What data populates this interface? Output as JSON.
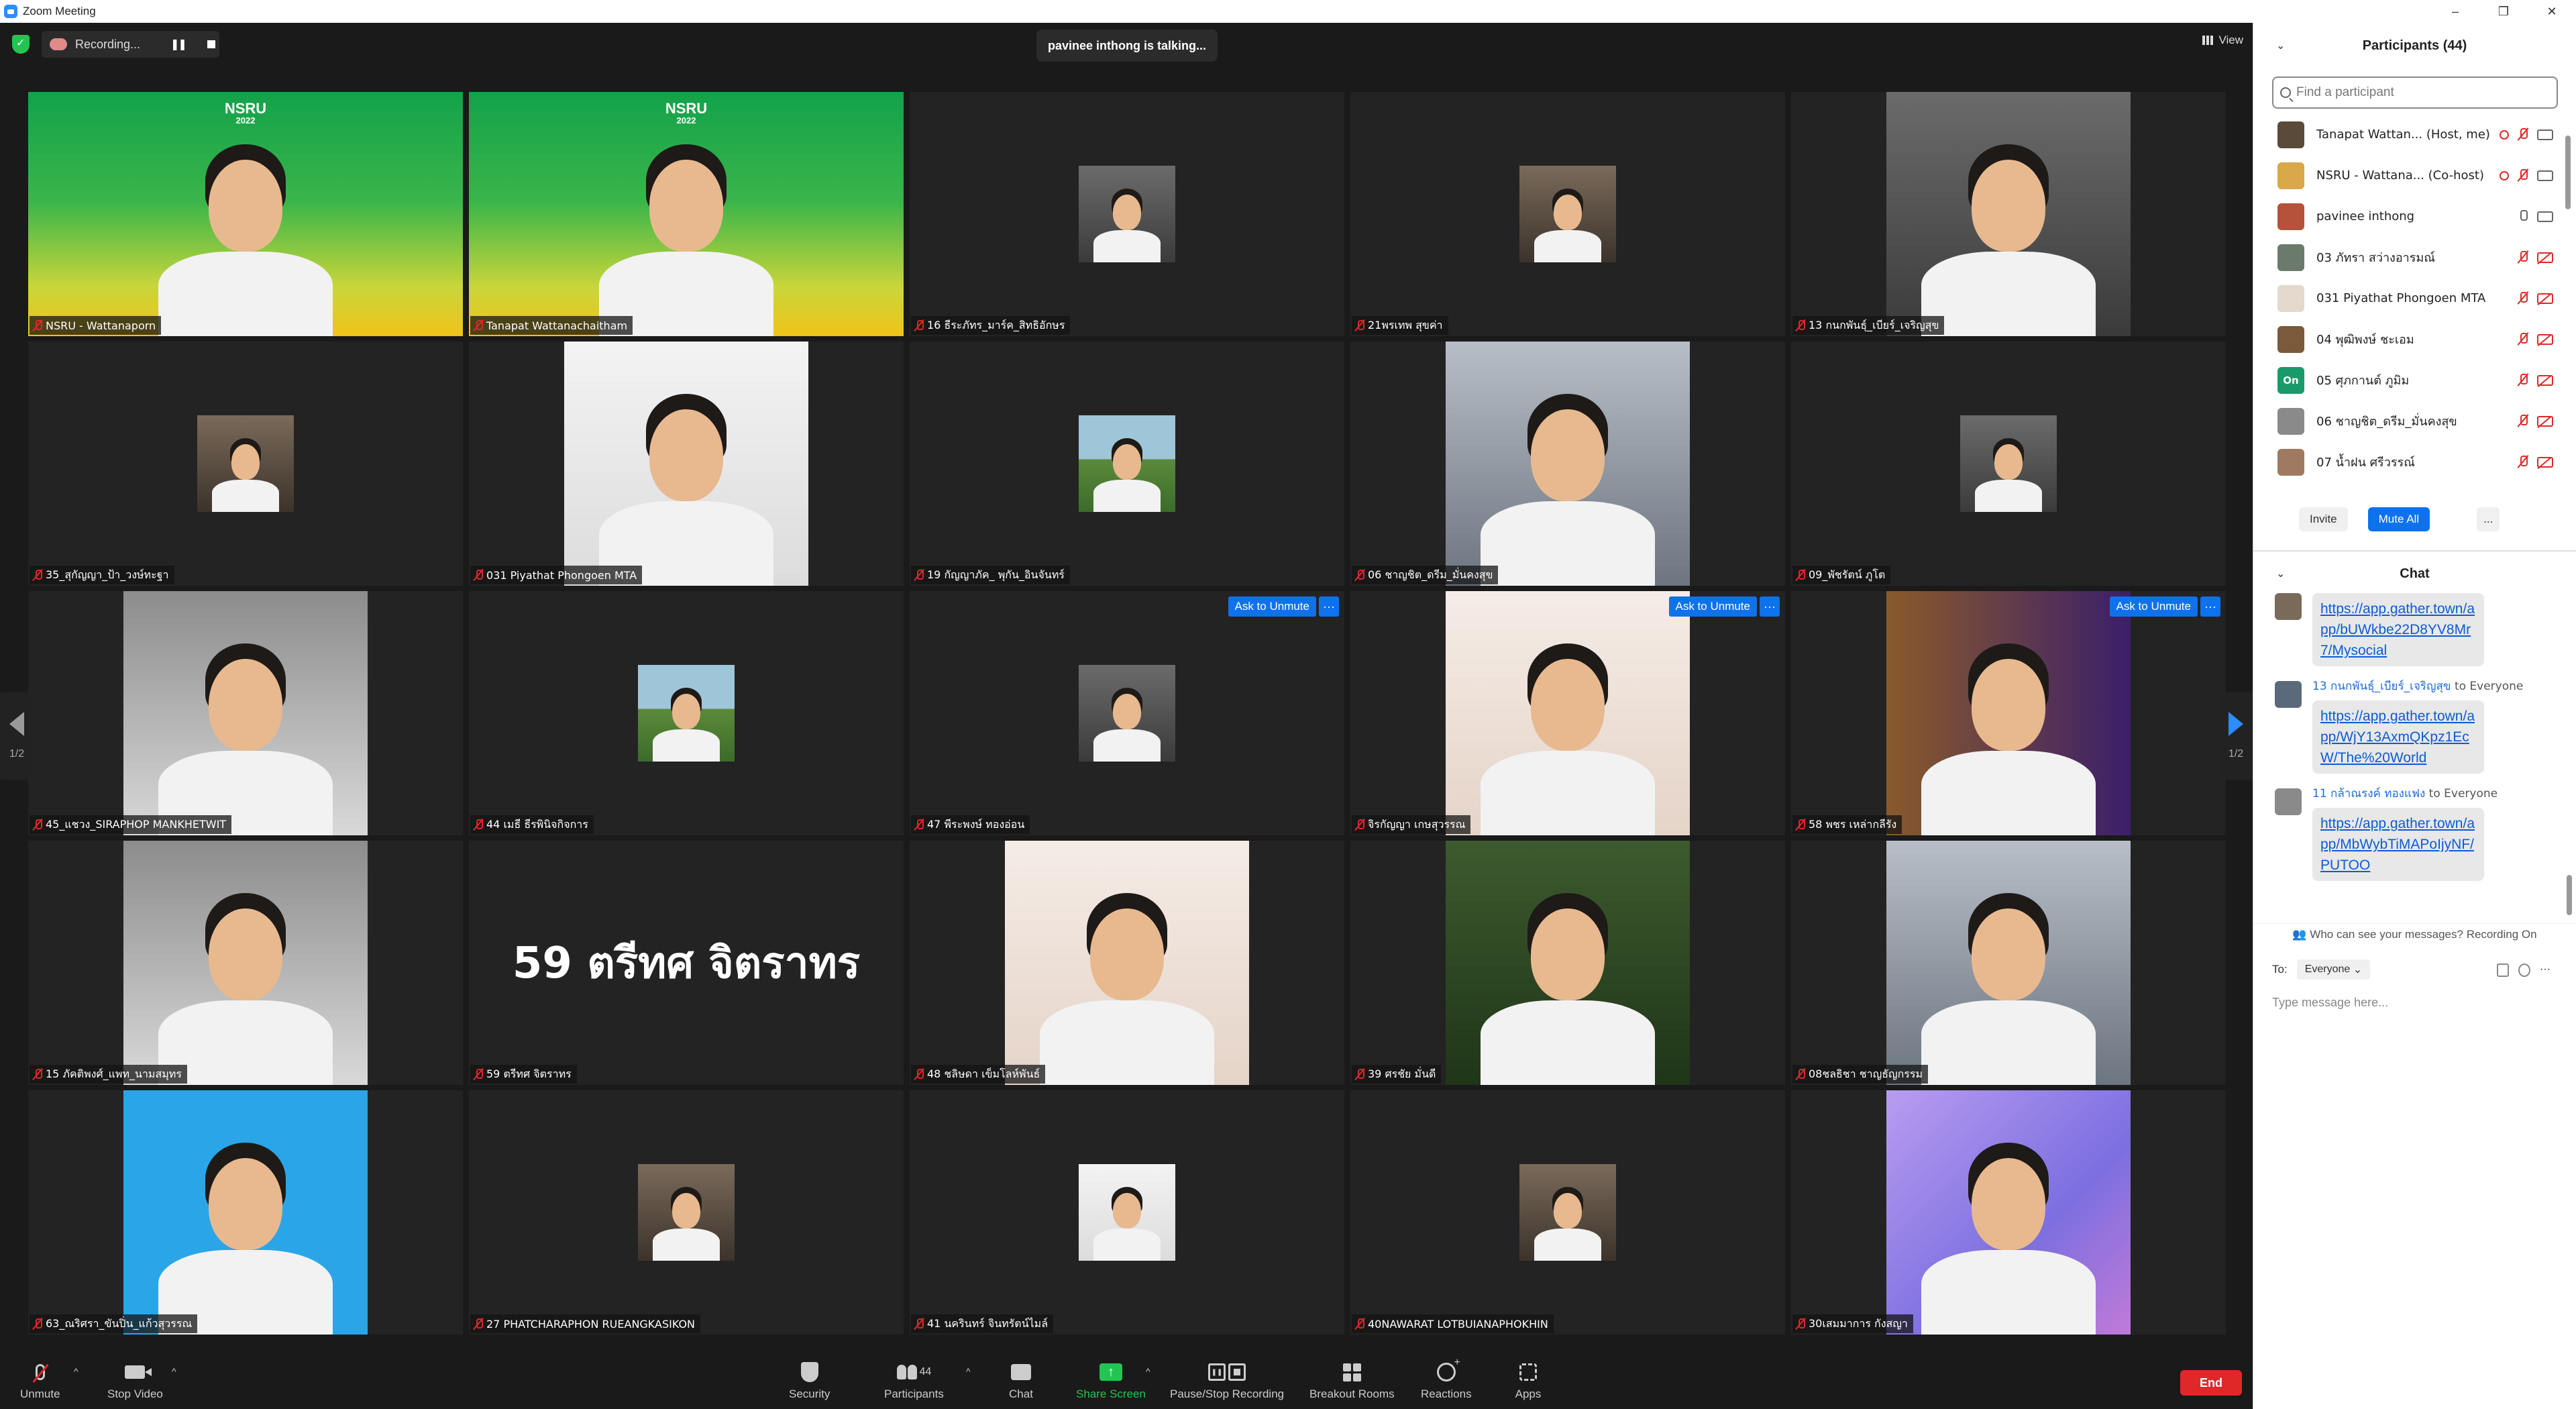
{
  "window": {
    "title": "Zoom Meeting"
  },
  "topbar": {
    "recording_label": "Recording...",
    "talking": "pavinee inthong is talking...",
    "view_label": "View"
  },
  "tiles": [
    {
      "name": "NSRU - Wattanaporn",
      "feed": "full",
      "bg": "green-yellow",
      "watermark": "NSRU",
      "watermark_sub": "2022",
      "active": true
    },
    {
      "name": "Tanapat Wattanachaitham",
      "feed": "full",
      "bg": "green-yellow",
      "watermark": "NSRU",
      "watermark_sub": "2022"
    },
    {
      "name": "16 ธีระภัทร_มาร์ค_สิทธิอักษร",
      "feed": "small",
      "bg": "gray"
    },
    {
      "name": "21พรเทพ สุขค่า",
      "feed": "small",
      "bg": "room"
    },
    {
      "name": "13 กนกพันธุ์_เบียร์_เจริญสุข",
      "feed": "portrait",
      "bg": "gray"
    },
    {
      "name": "35_สุกัญญา_ป้า_วงษ์ทะฐา",
      "feed": "small",
      "bg": "room"
    },
    {
      "name": "031 Piyathat Phongoen MTA",
      "feed": "portrait",
      "bg": "white"
    },
    {
      "name": "19 กัญญาภัค_ พุกัน_อินจันทร์",
      "feed": "small",
      "bg": "field"
    },
    {
      "name": "06 ชาญชิต_ดรีม_มั่นคงสุข",
      "feed": "portrait",
      "bg": "street"
    },
    {
      "name": "09_พัชรัตน์ ภูโต",
      "feed": "small",
      "bg": "gray"
    },
    {
      "name": "45_แชวง_SIRAPHOP MANKHETWIT",
      "feed": "portrait",
      "bg": "office"
    },
    {
      "name": "44 เมธี ธีรพินิจกิจการ",
      "feed": "small",
      "bg": "field"
    },
    {
      "name": "47 พีระพงษ์ ทองอ่อน",
      "feed": "small",
      "bg": "gray",
      "ask_unmute": true
    },
    {
      "name": "จิรกัญญา เกษสุวรรณ",
      "feed": "portrait",
      "bg": "pink",
      "ask_unmute": true
    },
    {
      "name": "58 พชร เหล่ากลีรัง",
      "feed": "portrait",
      "bg": "sunset",
      "ask_unmute": true
    },
    {
      "name": "15 ภัคติพงศ์_แพท_นามสมุทร",
      "feed": "portrait",
      "bg": "office"
    },
    {
      "name": "59 ตรีทศ จิตราทร",
      "feed": "none",
      "bg": "none",
      "big_name": "59 ตรีทศ จิตราทร"
    },
    {
      "name": "48 ชลิษดา เข็มโลห์พันธ์",
      "feed": "portrait",
      "bg": "pink"
    },
    {
      "name": "39 ศรชัย มั่นดี",
      "feed": "portrait",
      "bg": "tree"
    },
    {
      "name": "08ชลธิชา ชาญธัญกรรม",
      "feed": "portrait",
      "bg": "street"
    },
    {
      "name": "63_ณริศรา_ขันปิ่น_แก้วสุวรรณ",
      "feed": "portrait",
      "bg": "blue"
    },
    {
      "name": "27 PHATCHARAPHON RUEANGKASIKON",
      "feed": "small",
      "bg": "room"
    },
    {
      "name": "41 นครินทร์ จินทรัตน์ไมล์",
      "feed": "small",
      "bg": "white"
    },
    {
      "name": "40NAWARAT LOTBUIANAPHOKHIN",
      "feed": "small",
      "bg": "room"
    },
    {
      "name": "30เสมมาการ กังสญา",
      "feed": "portrait",
      "bg": "purple"
    }
  ],
  "ask_unmute_label": "Ask to Unmute",
  "more_label": "···",
  "pager": {
    "left_page": "1/2",
    "right_page": "1/2"
  },
  "toolbar": {
    "unmute": "Unmute",
    "stop_video": "Stop Video",
    "security": "Security",
    "participants": "Participants",
    "participants_count": "44",
    "chat": "Chat",
    "share_screen": "Share Screen",
    "pause_stop_recording": "Pause/Stop Recording",
    "breakout_rooms": "Breakout Rooms",
    "reactions": "Reactions",
    "apps": "Apps",
    "end": "End"
  },
  "participants_panel": {
    "title": "Participants (44)",
    "search_placeholder": "Find a participant",
    "rows": [
      {
        "name": "Tanapat Wattan...  (Host, me)",
        "avatar_color": "#5a4a3a",
        "rec": true,
        "mic": "off",
        "cam": "on"
      },
      {
        "name": "NSRU - Wattana...  (Co-host)",
        "avatar_color": "#d9a84a",
        "rec": true,
        "mic": "off",
        "cam": "on"
      },
      {
        "name": "pavinee inthong",
        "avatar_color": "#b5523b",
        "rec": false,
        "mic": "on",
        "cam": "on"
      },
      {
        "name": "03 ภัทรา สว่างอารมณ์",
        "avatar_color": "#6b7b6b",
        "rec": false,
        "mic": "off",
        "cam": "off"
      },
      {
        "name": "031 Piyathat Phongoen MTA",
        "avatar_color": "#e5d8cc",
        "rec": false,
        "mic": "off",
        "cam": "off"
      },
      {
        "name": "04 พุฒิพงษ์ ชะเอม",
        "avatar_color": "#7a5a3a",
        "rec": false,
        "mic": "off",
        "cam": "off"
      },
      {
        "name": "05 ศุภกานต์ ภูมิม",
        "avatar_color": "#1a9a6a",
        "avatar_text": "On",
        "rec": false,
        "mic": "off",
        "cam": "off"
      },
      {
        "name": "06 ชาญชิต_ดรีม_มั่นคงสุข",
        "avatar_color": "#8a8a8a",
        "rec": false,
        "mic": "off",
        "cam": "off"
      },
      {
        "name": "07 น้ำฝน ศรีวรรณ์",
        "avatar_color": "#a07a60",
        "rec": false,
        "mic": "off",
        "cam": "off"
      }
    ],
    "invite": "Invite",
    "mute_all": "Mute All",
    "more": "..."
  },
  "chat_panel": {
    "title": "Chat",
    "messages": [
      {
        "from": "",
        "to": "",
        "text": "https://app.gather.town/app/bUWkbe22D8YV8Mr7/Mysocial",
        "avatar_color": "#7a6a5a"
      },
      {
        "from": "13 กนกพันธุ์_เบียร์_เจริญสุข",
        "to": "to Everyone",
        "text": "https://app.gather.town/app/WjY13AxmQKpz1EcW/The%20World",
        "avatar_color": "#5a6a7a"
      },
      {
        "from": "11 กล้าณรงค์ ทองแฟง",
        "to": "to Everyone",
        "text": "https://app.gather.town/app/MbWybTiMAPoIjyNF/PUTOO",
        "avatar_color": "#8a8a8a"
      }
    ],
    "visibility": "Who can see your messages? Recording On",
    "to_label": "To:",
    "to_value": "Everyone",
    "input_placeholder": "Type message here..."
  }
}
